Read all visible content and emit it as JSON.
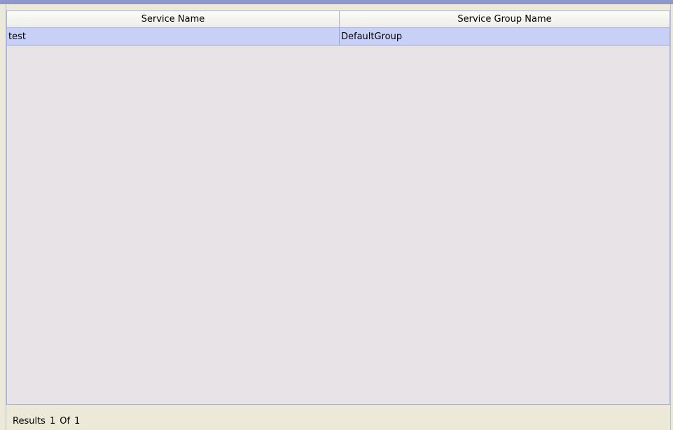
{
  "table": {
    "columns": [
      {
        "label": "Service Name"
      },
      {
        "label": "Service Group Name"
      }
    ],
    "rows": [
      {
        "service_name": "test",
        "service_group_name": "DefaultGroup"
      }
    ]
  },
  "status": {
    "results_label": "Results",
    "current": "1",
    "of_label": "Of",
    "total": "1"
  }
}
